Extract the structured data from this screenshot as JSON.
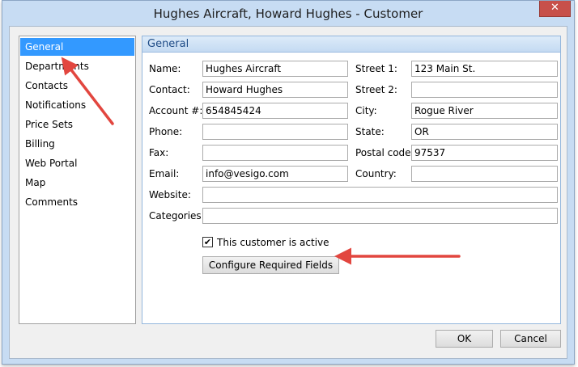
{
  "window": {
    "title": "Hughes Aircraft, Howard Hughes - Customer",
    "close_label": "✕"
  },
  "sidebar": {
    "items": [
      {
        "label": "General",
        "selected": true
      },
      {
        "label": "Departments"
      },
      {
        "label": "Contacts"
      },
      {
        "label": "Notifications"
      },
      {
        "label": "Price Sets"
      },
      {
        "label": "Billing"
      },
      {
        "label": "Web Portal"
      },
      {
        "label": "Map"
      },
      {
        "label": "Comments"
      }
    ]
  },
  "panel": {
    "header": "General"
  },
  "form": {
    "name": {
      "label": "Name:",
      "value": "Hughes Aircraft"
    },
    "contact": {
      "label": "Contact:",
      "value": "Howard Hughes"
    },
    "account": {
      "label": "Account #:",
      "value": "654845424"
    },
    "phone": {
      "label": "Phone:",
      "value": ""
    },
    "fax": {
      "label": "Fax:",
      "value": ""
    },
    "email": {
      "label": "Email:",
      "value": "info@vesigo.com"
    },
    "website": {
      "label": "Website:",
      "value": ""
    },
    "categories": {
      "label": "Categories:",
      "value": ""
    },
    "street1": {
      "label": "Street 1:",
      "value": "123 Main St."
    },
    "street2": {
      "label": "Street 2:",
      "value": ""
    },
    "city": {
      "label": "City:",
      "value": "Rogue River"
    },
    "state": {
      "label": "State:",
      "value": "OR"
    },
    "postal": {
      "label": "Postal code:",
      "value": "97537"
    },
    "country": {
      "label": "Country:",
      "value": ""
    },
    "active": {
      "label": "This customer is active",
      "checked": true,
      "mark": "✔"
    },
    "configure_label": "Configure Required Fields"
  },
  "footer": {
    "ok_label": "OK",
    "cancel_label": "Cancel"
  },
  "annotation_color": "#e2463f"
}
